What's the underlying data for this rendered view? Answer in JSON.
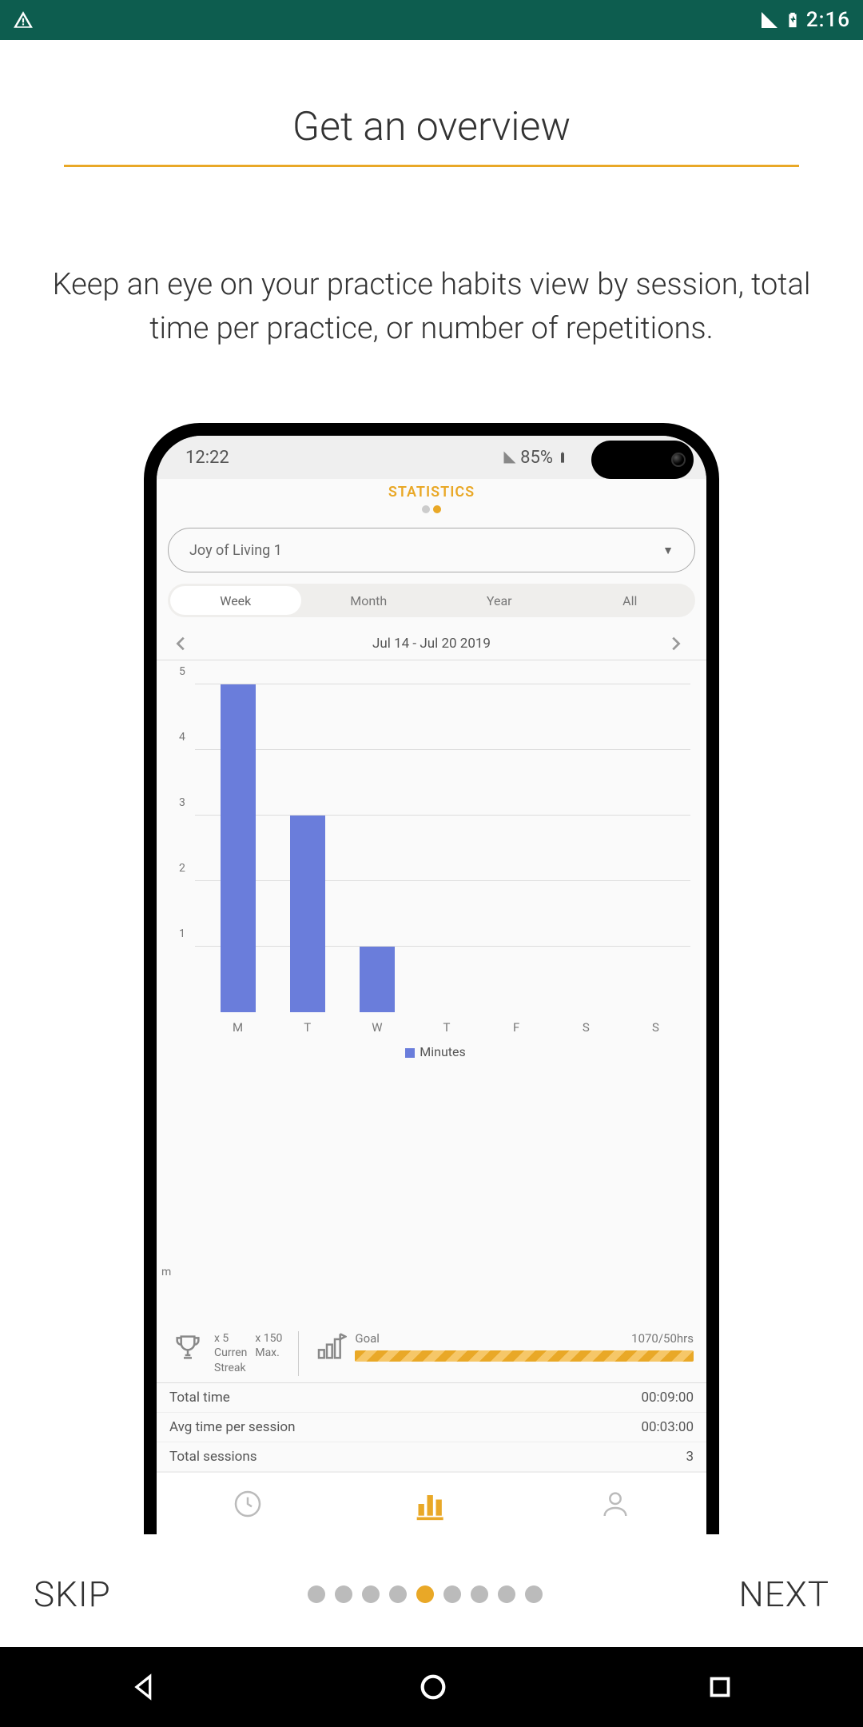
{
  "outer_status": {
    "time": "2:16",
    "battery": "85%"
  },
  "onboarding": {
    "title": "Get an overview",
    "subtitle": "Keep an eye on your practice habits view by session, total time per practice, or number of repetitions.",
    "skip": "SKIP",
    "next": "NEXT",
    "page_count": 9,
    "page_active_index": 4
  },
  "phone_status": {
    "time": "12:22",
    "battery": "85%"
  },
  "statistics": {
    "header": "STATISTICS",
    "dropdown_value": "Joy of Living 1",
    "range_tabs": [
      "Week",
      "Month",
      "Year",
      "All"
    ],
    "range_active_index": 0,
    "date_range": "Jul 14 - Jul 20 2019",
    "legend_label": "Minutes",
    "streak": {
      "col1_top": "x 5",
      "col1_mid": "Curren",
      "col1_bot": "Streak",
      "col2_top": "x 150",
      "col2_mid": "Max."
    },
    "goal": {
      "label": "Goal",
      "value": "1070/50hrs"
    },
    "rows": {
      "total_time_label": "Total time",
      "total_time_value": "00:09:00",
      "avg_label": "Avg time per session",
      "avg_value": "00:03:00",
      "sessions_label": "Total sessions",
      "sessions_value": "3"
    }
  },
  "chart_data": {
    "type": "bar",
    "title": "STATISTICS",
    "xlabel": "",
    "ylabel": "m",
    "ylim": [
      0,
      5
    ],
    "y_ticks": [
      1,
      2,
      3,
      4,
      5
    ],
    "categories": [
      "M",
      "T",
      "W",
      "T",
      "F",
      "S",
      "S"
    ],
    "series": [
      {
        "name": "Minutes",
        "values": [
          5,
          3,
          1,
          0,
          0,
          0,
          0
        ]
      }
    ]
  }
}
